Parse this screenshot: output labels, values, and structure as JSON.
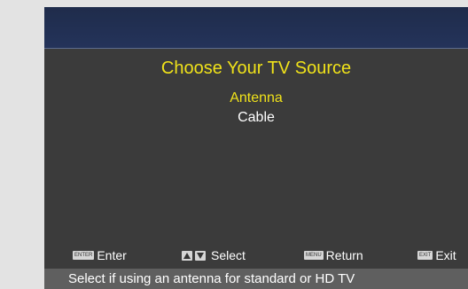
{
  "menu": {
    "title": "Choose Your TV Source",
    "options": [
      {
        "label": "Antenna",
        "selected": true
      },
      {
        "label": "Cable",
        "selected": false
      }
    ]
  },
  "hints": {
    "enter": {
      "key": "ENTER",
      "label": "Enter"
    },
    "select": {
      "keys": [
        "up-arrow-icon",
        "down-arrow-icon"
      ],
      "label": "Select"
    },
    "return": {
      "key": "MENU",
      "label": "Return"
    },
    "exit": {
      "key": "EXIT",
      "label": "Exit"
    }
  },
  "status": {
    "text": "Select if using an antenna for standard or HD TV"
  },
  "colors": {
    "selected_text": "#f0e21a",
    "header": "#24335a",
    "panel": "#3b3b3b",
    "status_bar": "#5f5f5f"
  }
}
